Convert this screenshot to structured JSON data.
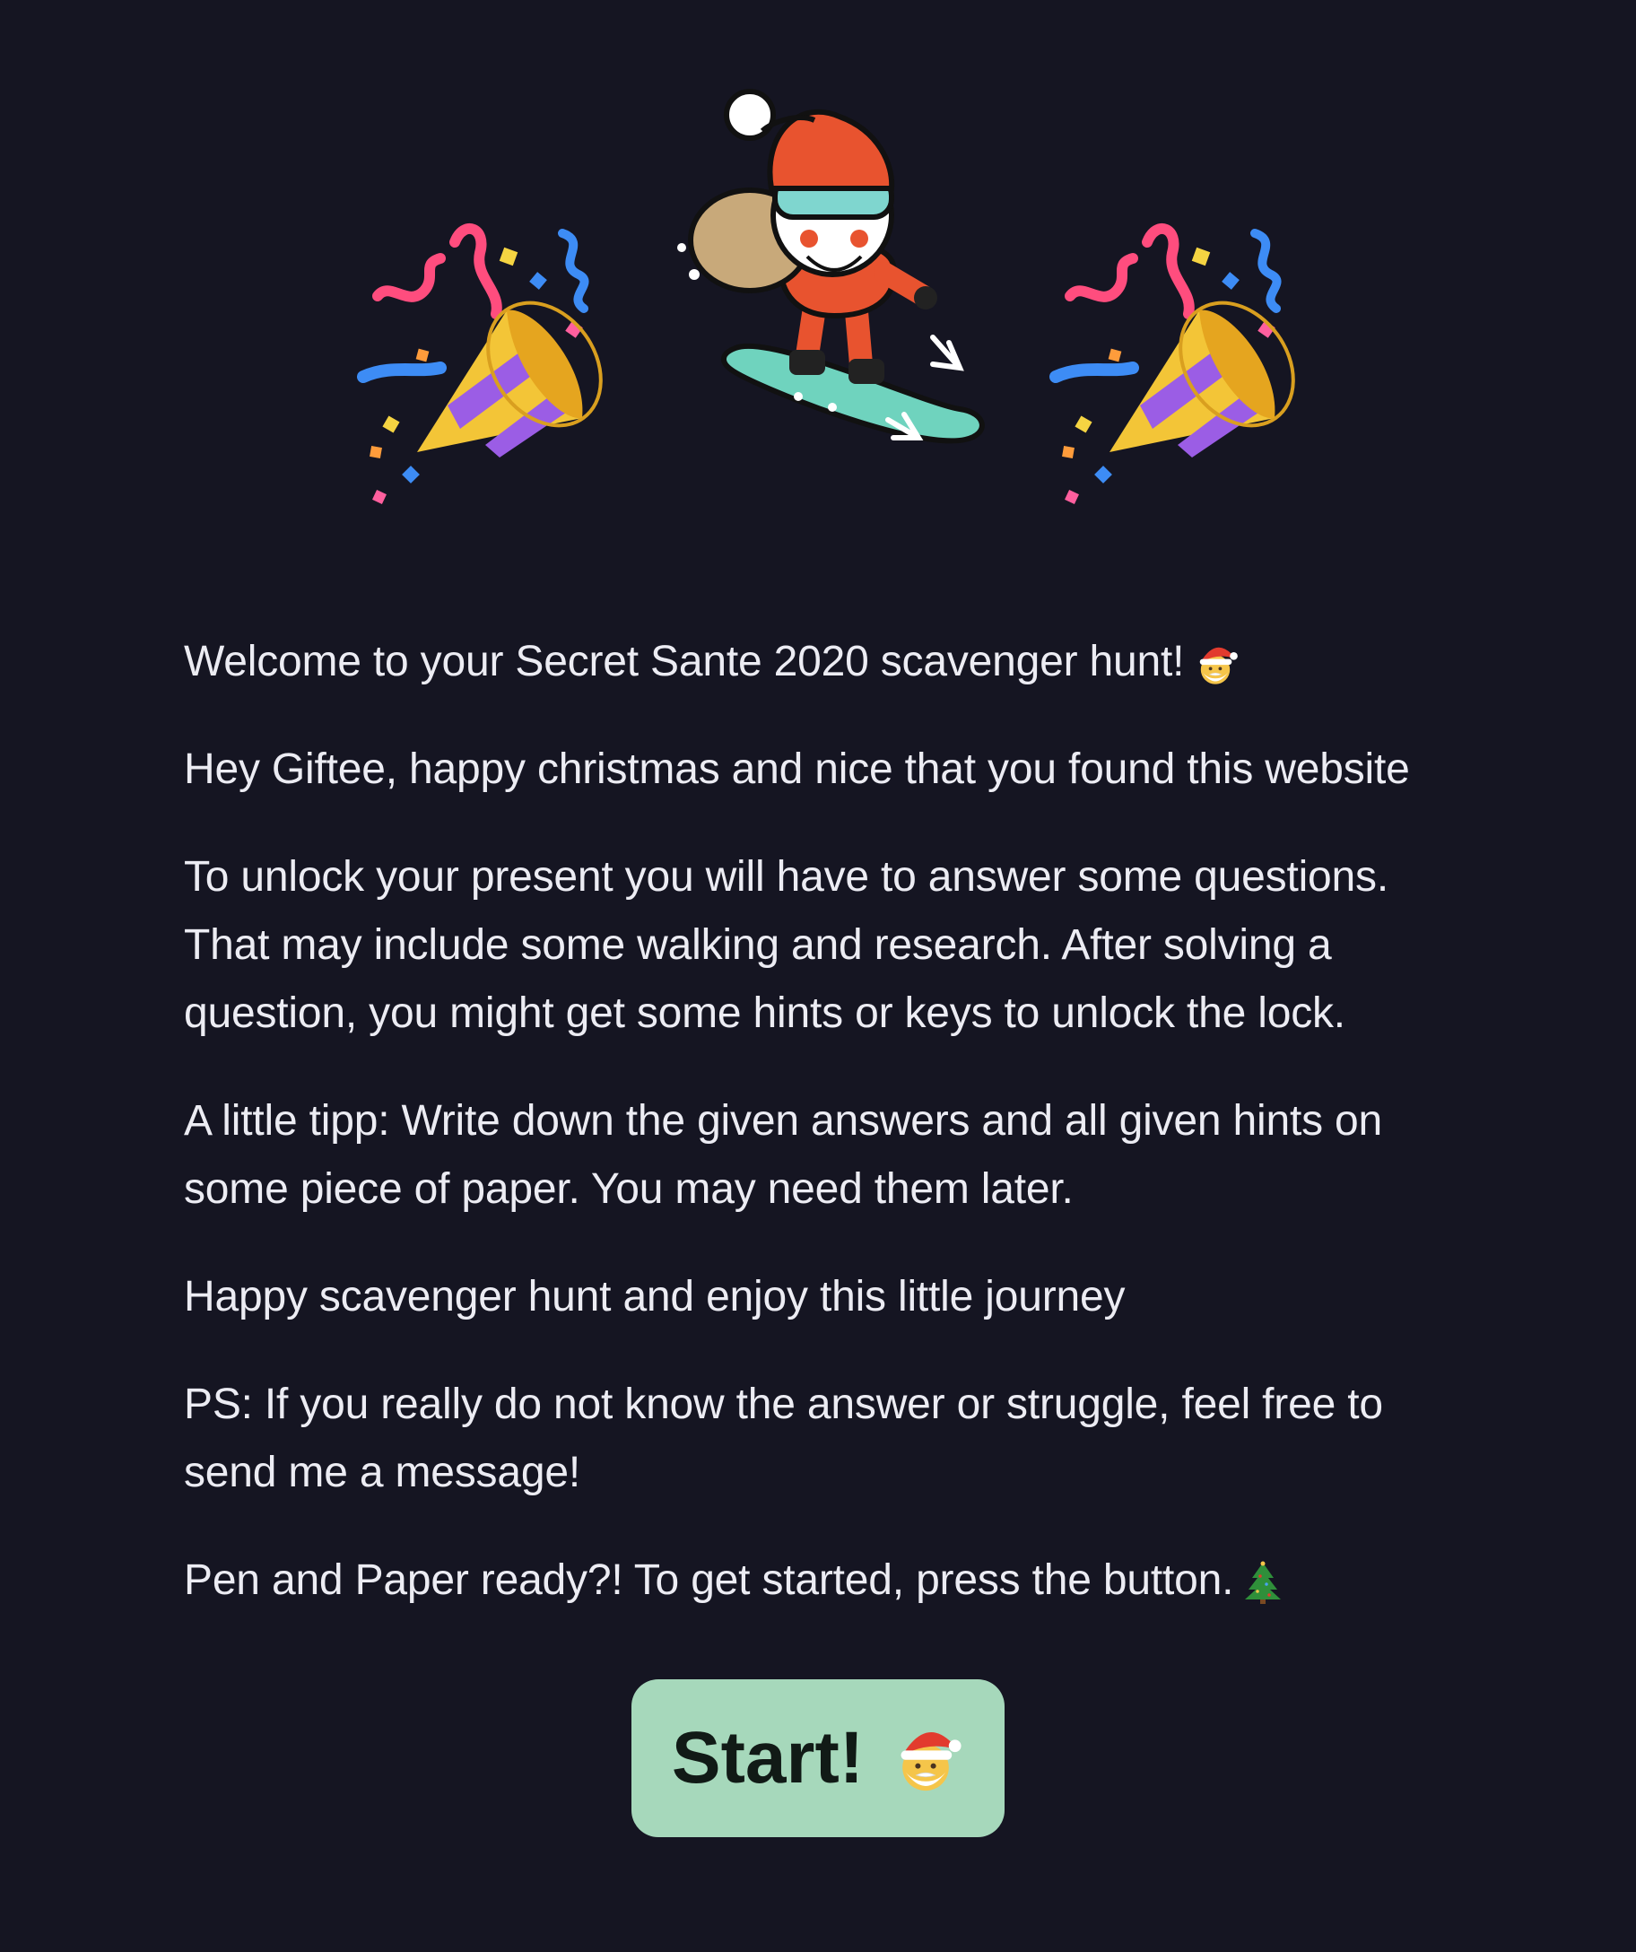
{
  "hero": {
    "left_icon": "party-popper-icon",
    "center_icon": "snowboarding-santa-mascot",
    "right_icon": "party-popper-icon"
  },
  "intro": {
    "welcome": "Welcome to your Secret Sante 2020 scavenger hunt!",
    "welcome_icon": "santa-face-icon",
    "greeting": "Hey Giftee, happy christmas and nice that you found this website",
    "instructions": "To unlock your present you will have to answer some questions. That may include some walking and research. After solving a question, you might get some hints or keys to unlock the lock.",
    "tip": "A little tipp: Write down the given answers and all given hints on some piece of paper. You may need them later.",
    "wish": "Happy scavenger hunt and enjoy this little journey",
    "ps": "PS: If you really do not know the answer or struggle, feel free to send me a message!",
    "ready": "Pen and Paper ready?! To get started, press the button.",
    "ready_icon": "christmas-tree-icon"
  },
  "start_button": {
    "label": "Start!",
    "icon": "santa-face-icon"
  },
  "colors": {
    "background": "#151522",
    "text": "#ececf3",
    "button_bg": "#a6d8bb",
    "button_text": "#111a16"
  }
}
